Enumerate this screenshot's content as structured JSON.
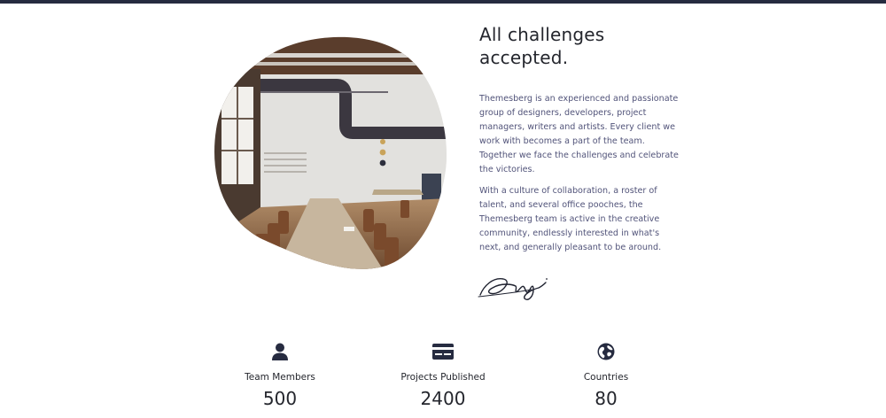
{
  "about": {
    "title_line1": "All challenges",
    "title_line2": "accepted.",
    "paragraph1": "Themesberg is an experienced and passionate group of designers, developers, project managers, writers and artists. Every client we work with becomes a part of the team. Together we face the challenges and celebrate the victories.",
    "paragraph2": "With a culture of collaboration, a roster of talent, and several office pooches, the Themesberg team is active in the creative community, endlessly interested in what's next, and generally pleasant to be around.",
    "image_icon": "office-photo",
    "signature_icon": "signature"
  },
  "stats": [
    {
      "icon": "user-icon",
      "label": "Team Members",
      "value": "500"
    },
    {
      "icon": "credit-card-icon",
      "label": "Projects Published",
      "value": "2400"
    },
    {
      "icon": "globe-icon",
      "label": "Countries",
      "value": "80"
    }
  ],
  "colors": {
    "dark": "#262b40",
    "text": "#24262d",
    "muted": "#52547a"
  }
}
